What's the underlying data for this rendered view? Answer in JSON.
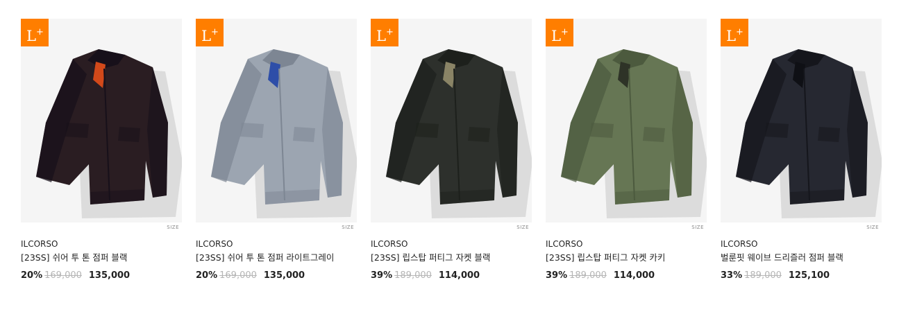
{
  "products": [
    {
      "badge": "L",
      "badge_sup": "+",
      "size_label": "SIZE",
      "brand": "ILCORSO",
      "name": "[23SS] 쉬어 투 톤 점퍼 블랙",
      "discount": "20%",
      "original_price": "169,000",
      "sale_price": "135,000",
      "colors": {
        "body": "#2a1d22",
        "shade": "#17101a",
        "accent": "#d2491a"
      }
    },
    {
      "badge": "L",
      "badge_sup": "+",
      "size_label": "SIZE",
      "brand": "ILCORSO",
      "name": "[23SS] 쉬어 투 톤 점퍼 라이트그레이",
      "discount": "20%",
      "original_price": "169,000",
      "sale_price": "135,000",
      "colors": {
        "body": "#9ca5b1",
        "shade": "#7d8693",
        "accent": "#2e4ea8"
      }
    },
    {
      "badge": "L",
      "badge_sup": "+",
      "size_label": "SIZE",
      "brand": "ILCORSO",
      "name": "[23SS] 립스탑 퍼티그 자켓 블랙",
      "discount": "39%",
      "original_price": "189,000",
      "sale_price": "114,000",
      "colors": {
        "body": "#2d302c",
        "shade": "#1d201c",
        "accent": "#8a8466"
      }
    },
    {
      "badge": "L",
      "badge_sup": "+",
      "size_label": "SIZE",
      "brand": "ILCORSO",
      "name": "[23SS] 립스탑 퍼티그 자켓 카키",
      "discount": "39%",
      "original_price": "189,000",
      "sale_price": "114,000",
      "colors": {
        "body": "#667654",
        "shade": "#4c5a3e",
        "accent": "#2e3327"
      }
    },
    {
      "badge": "L",
      "badge_sup": "+",
      "size_label": "SIZE",
      "brand": "ILCORSO",
      "name": "벌룬핏 웨이브 드리즐러 점퍼 블랙",
      "discount": "33%",
      "original_price": "189,000",
      "sale_price": "125,100",
      "colors": {
        "body": "#262831",
        "shade": "#15161c",
        "accent": "#0f1015"
      }
    }
  ]
}
